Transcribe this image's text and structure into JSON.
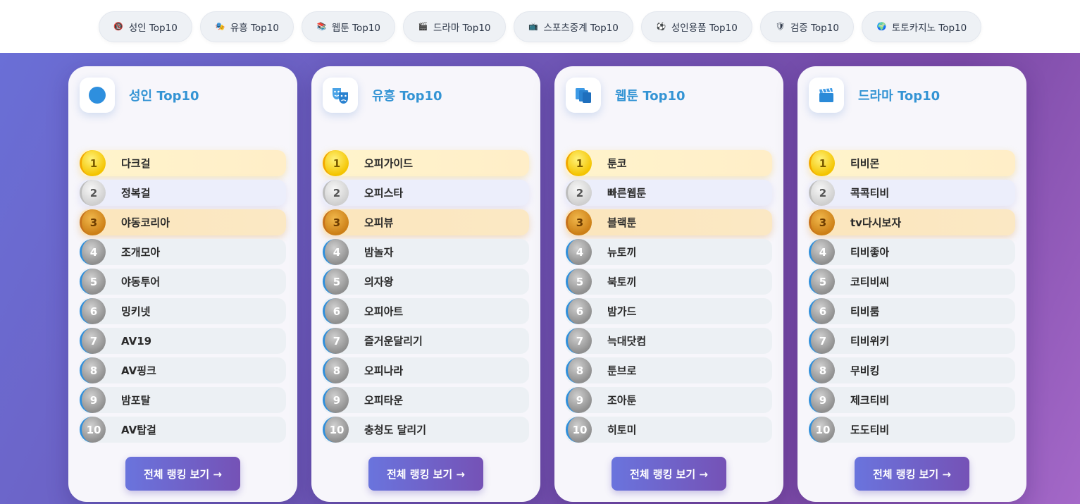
{
  "nav": [
    {
      "icon": "🔞",
      "label": "성인 Top10"
    },
    {
      "icon": "🎭",
      "label": "유흥 Top10"
    },
    {
      "icon": "📚",
      "label": "웹툰 Top10"
    },
    {
      "icon": "🎬",
      "label": "드라마 Top10"
    },
    {
      "icon": "📺",
      "label": "스포츠중계 Top10"
    },
    {
      "icon": "⚽",
      "label": "성인용품 Top10"
    },
    {
      "icon": "🛡",
      "label": "검증 Top10"
    },
    {
      "icon": "🌍",
      "label": "토토카지노 Top10"
    }
  ],
  "cards": [
    {
      "title": "성인 Top10",
      "icon": "circle-icon",
      "button": "전체 랭킹 보기 →",
      "items": [
        {
          "rank": "1",
          "name": "다크걸"
        },
        {
          "rank": "2",
          "name": "정복걸"
        },
        {
          "rank": "3",
          "name": "야동코리아"
        },
        {
          "rank": "4",
          "name": "조개모아"
        },
        {
          "rank": "5",
          "name": "야동투어"
        },
        {
          "rank": "6",
          "name": "밍키넷"
        },
        {
          "rank": "7",
          "name": "AV19"
        },
        {
          "rank": "8",
          "name": "AV핑크"
        },
        {
          "rank": "9",
          "name": "밤포탈"
        },
        {
          "rank": "10",
          "name": "AV탑걸"
        }
      ]
    },
    {
      "title": "유흥 Top10",
      "icon": "theater-masks-icon",
      "button": "전체 랭킹 보기 →",
      "items": [
        {
          "rank": "1",
          "name": "오피가이드"
        },
        {
          "rank": "2",
          "name": "오피스타"
        },
        {
          "rank": "3",
          "name": "오피뷰"
        },
        {
          "rank": "4",
          "name": "밤놀자"
        },
        {
          "rank": "5",
          "name": "의자왕"
        },
        {
          "rank": "6",
          "name": "오피아트"
        },
        {
          "rank": "7",
          "name": "즐거운달리기"
        },
        {
          "rank": "8",
          "name": "오피나라"
        },
        {
          "rank": "9",
          "name": "오피타운"
        },
        {
          "rank": "10",
          "name": "충청도 달리기"
        }
      ]
    },
    {
      "title": "웹툰 Top10",
      "icon": "books-icon",
      "button": "전체 랭킹 보기 →",
      "items": [
        {
          "rank": "1",
          "name": "툰코"
        },
        {
          "rank": "2",
          "name": "빠른웹툰"
        },
        {
          "rank": "3",
          "name": "블랙툰"
        },
        {
          "rank": "4",
          "name": "뉴토끼"
        },
        {
          "rank": "5",
          "name": "북토끼"
        },
        {
          "rank": "6",
          "name": "밤가드"
        },
        {
          "rank": "7",
          "name": "늑대닷컴"
        },
        {
          "rank": "8",
          "name": "툰브로"
        },
        {
          "rank": "9",
          "name": "조아툰"
        },
        {
          "rank": "10",
          "name": "히토미"
        }
      ]
    },
    {
      "title": "드라마 Top10",
      "icon": "clapperboard-icon",
      "button": "전체 랭킹 보기 →",
      "items": [
        {
          "rank": "1",
          "name": "티비몬"
        },
        {
          "rank": "2",
          "name": "콕콕티비"
        },
        {
          "rank": "3",
          "name": "tv다시보자"
        },
        {
          "rank": "4",
          "name": "티비좋아"
        },
        {
          "rank": "5",
          "name": "코티비씨"
        },
        {
          "rank": "6",
          "name": "티비룸"
        },
        {
          "rank": "7",
          "name": "티비위키"
        },
        {
          "rank": "8",
          "name": "무비킹"
        },
        {
          "rank": "9",
          "name": "제크티비"
        },
        {
          "rank": "10",
          "name": "도도티비"
        }
      ]
    }
  ]
}
